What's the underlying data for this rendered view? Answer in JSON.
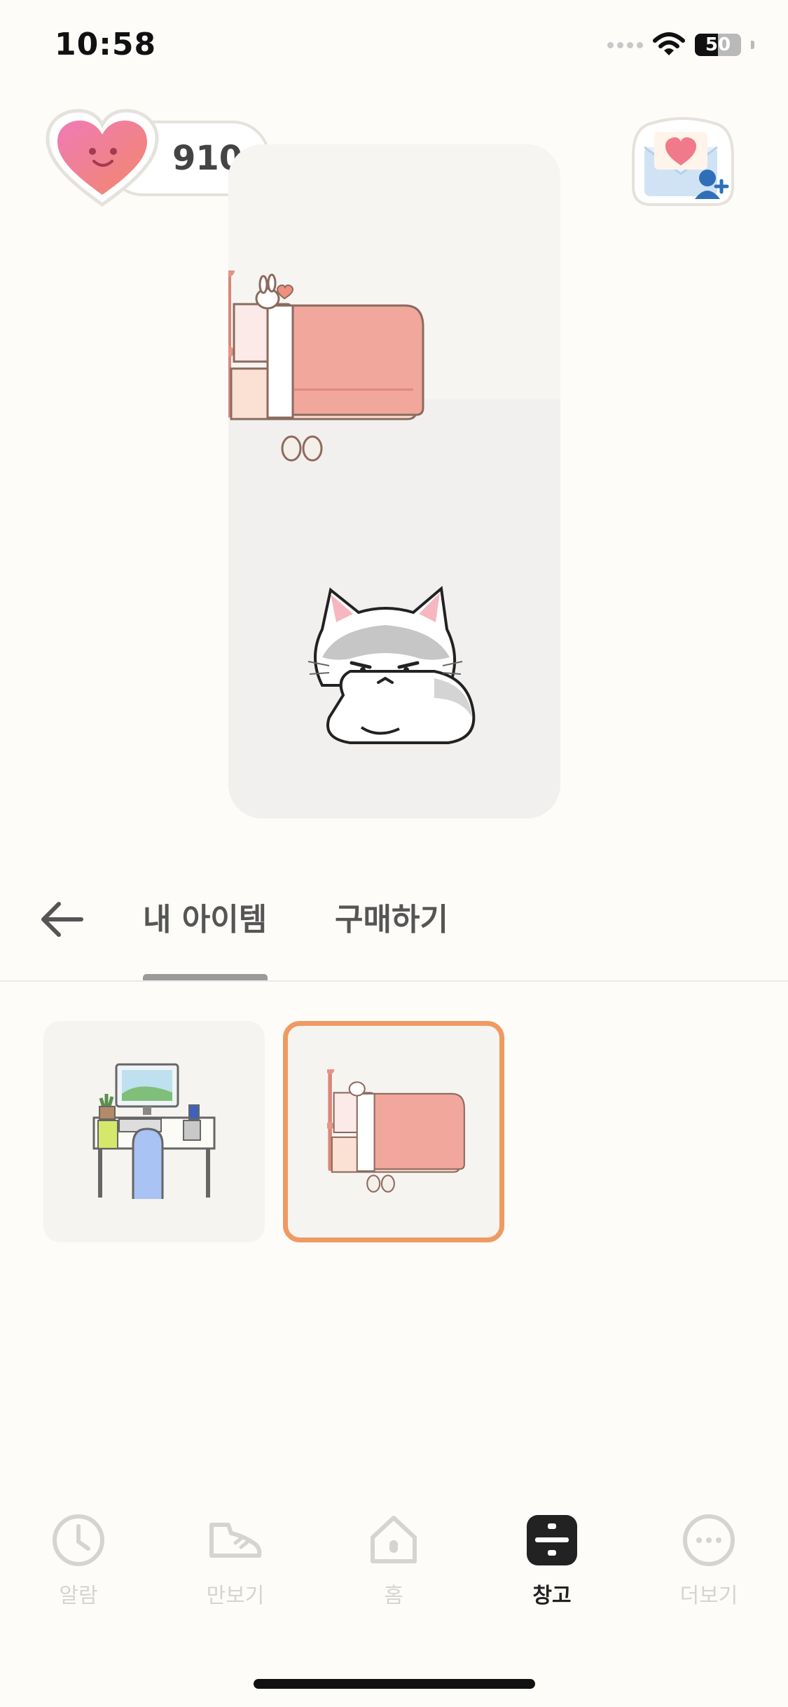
{
  "status_bar": {
    "time": "10:58",
    "battery": "50"
  },
  "hearts": {
    "count": "910"
  },
  "tabs": {
    "my_items": "내 아이템",
    "buy": "구매하기"
  },
  "items": [
    {
      "name": "desk-set",
      "selected": false
    },
    {
      "name": "bed",
      "selected": true
    }
  ],
  "nav": [
    {
      "label": "알람",
      "icon": "clock-icon",
      "active": false
    },
    {
      "label": "만보기",
      "icon": "sneaker-icon",
      "active": false
    },
    {
      "label": "홈",
      "icon": "home-icon",
      "active": false
    },
    {
      "label": "창고",
      "icon": "storage-icon",
      "active": true
    },
    {
      "label": "더보기",
      "icon": "more-icon",
      "active": false
    }
  ],
  "colors": {
    "background": "#fdfcf8",
    "selected_border": "#ef9a62",
    "heart": "#f0708e",
    "nav_inactive": "#d6d4d0",
    "nav_active": "#222222"
  }
}
